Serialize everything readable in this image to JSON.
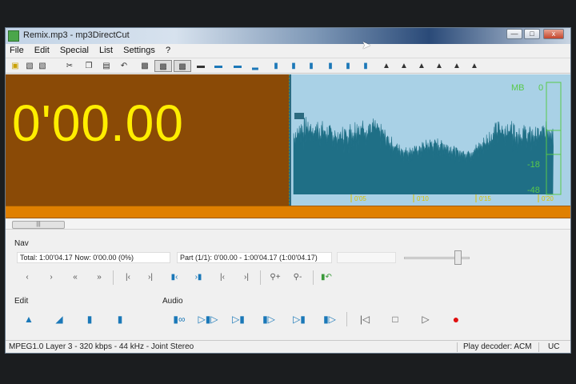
{
  "window": {
    "title": "Remix.mp3 - mp3DirectCut",
    "controls": {
      "minimize": "—",
      "maximize": "□",
      "close": "x"
    }
  },
  "menu": [
    "File",
    "Edit",
    "Special",
    "List",
    "Settings",
    "?"
  ],
  "display": {
    "time": "0'00.00"
  },
  "waveform": {
    "timeline_labels": [
      "0'05",
      "0'10",
      "0'15",
      "0'20"
    ],
    "meter_labels": [
      "MB",
      "0",
      "-18",
      "-48"
    ],
    "colors": {
      "background": "#a9d1e6",
      "wave": "#1f6f86",
      "meter": "#59c94a"
    }
  },
  "nav": {
    "label": "Nav",
    "total_now": "Total:  1:00'04.17   Now:  0'00.00   (0%)",
    "part": "Part (1/1):  0'00.00 - 1:00'04.17  (1:00'04.17)",
    "volume_level": 0.88
  },
  "edit": {
    "label": "Edit"
  },
  "audio": {
    "label": "Audio"
  },
  "status": {
    "format": "MPEG1.0 Layer 3 - 320 kbps - 44 kHz - Joint Stereo",
    "decoder": "Play decoder: ACM",
    "mode": "UC"
  },
  "colors": {
    "display_bg": "#8a4a06",
    "time_text": "#ffee00",
    "timeline_bar": "#e08000",
    "record": "#e01010"
  }
}
